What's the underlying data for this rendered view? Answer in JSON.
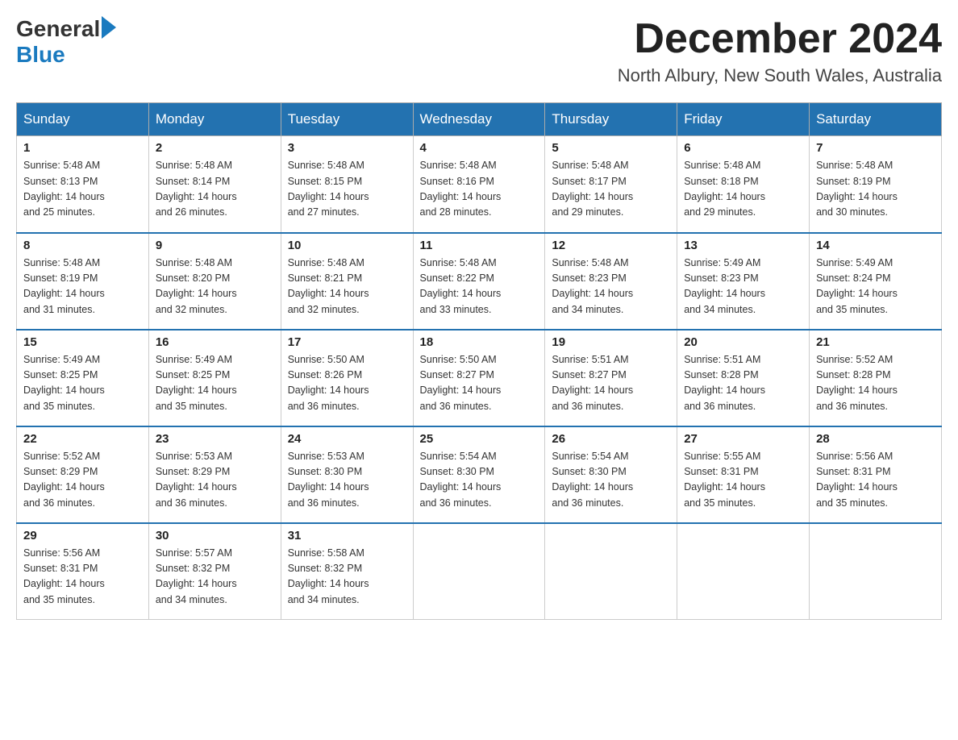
{
  "header": {
    "logo_text1": "General",
    "logo_text2": "Blue",
    "month_title": "December 2024",
    "location": "North Albury, New South Wales, Australia"
  },
  "weekdays": [
    "Sunday",
    "Monday",
    "Tuesday",
    "Wednesday",
    "Thursday",
    "Friday",
    "Saturday"
  ],
  "weeks": [
    [
      {
        "day": "1",
        "sunrise": "5:48 AM",
        "sunset": "8:13 PM",
        "daylight": "14 hours and 25 minutes."
      },
      {
        "day": "2",
        "sunrise": "5:48 AM",
        "sunset": "8:14 PM",
        "daylight": "14 hours and 26 minutes."
      },
      {
        "day": "3",
        "sunrise": "5:48 AM",
        "sunset": "8:15 PM",
        "daylight": "14 hours and 27 minutes."
      },
      {
        "day": "4",
        "sunrise": "5:48 AM",
        "sunset": "8:16 PM",
        "daylight": "14 hours and 28 minutes."
      },
      {
        "day": "5",
        "sunrise": "5:48 AM",
        "sunset": "8:17 PM",
        "daylight": "14 hours and 29 minutes."
      },
      {
        "day": "6",
        "sunrise": "5:48 AM",
        "sunset": "8:18 PM",
        "daylight": "14 hours and 29 minutes."
      },
      {
        "day": "7",
        "sunrise": "5:48 AM",
        "sunset": "8:19 PM",
        "daylight": "14 hours and 30 minutes."
      }
    ],
    [
      {
        "day": "8",
        "sunrise": "5:48 AM",
        "sunset": "8:19 PM",
        "daylight": "14 hours and 31 minutes."
      },
      {
        "day": "9",
        "sunrise": "5:48 AM",
        "sunset": "8:20 PM",
        "daylight": "14 hours and 32 minutes."
      },
      {
        "day": "10",
        "sunrise": "5:48 AM",
        "sunset": "8:21 PM",
        "daylight": "14 hours and 32 minutes."
      },
      {
        "day": "11",
        "sunrise": "5:48 AM",
        "sunset": "8:22 PM",
        "daylight": "14 hours and 33 minutes."
      },
      {
        "day": "12",
        "sunrise": "5:48 AM",
        "sunset": "8:23 PM",
        "daylight": "14 hours and 34 minutes."
      },
      {
        "day": "13",
        "sunrise": "5:49 AM",
        "sunset": "8:23 PM",
        "daylight": "14 hours and 34 minutes."
      },
      {
        "day": "14",
        "sunrise": "5:49 AM",
        "sunset": "8:24 PM",
        "daylight": "14 hours and 35 minutes."
      }
    ],
    [
      {
        "day": "15",
        "sunrise": "5:49 AM",
        "sunset": "8:25 PM",
        "daylight": "14 hours and 35 minutes."
      },
      {
        "day": "16",
        "sunrise": "5:49 AM",
        "sunset": "8:25 PM",
        "daylight": "14 hours and 35 minutes."
      },
      {
        "day": "17",
        "sunrise": "5:50 AM",
        "sunset": "8:26 PM",
        "daylight": "14 hours and 36 minutes."
      },
      {
        "day": "18",
        "sunrise": "5:50 AM",
        "sunset": "8:27 PM",
        "daylight": "14 hours and 36 minutes."
      },
      {
        "day": "19",
        "sunrise": "5:51 AM",
        "sunset": "8:27 PM",
        "daylight": "14 hours and 36 minutes."
      },
      {
        "day": "20",
        "sunrise": "5:51 AM",
        "sunset": "8:28 PM",
        "daylight": "14 hours and 36 minutes."
      },
      {
        "day": "21",
        "sunrise": "5:52 AM",
        "sunset": "8:28 PM",
        "daylight": "14 hours and 36 minutes."
      }
    ],
    [
      {
        "day": "22",
        "sunrise": "5:52 AM",
        "sunset": "8:29 PM",
        "daylight": "14 hours and 36 minutes."
      },
      {
        "day": "23",
        "sunrise": "5:53 AM",
        "sunset": "8:29 PM",
        "daylight": "14 hours and 36 minutes."
      },
      {
        "day": "24",
        "sunrise": "5:53 AM",
        "sunset": "8:30 PM",
        "daylight": "14 hours and 36 minutes."
      },
      {
        "day": "25",
        "sunrise": "5:54 AM",
        "sunset": "8:30 PM",
        "daylight": "14 hours and 36 minutes."
      },
      {
        "day": "26",
        "sunrise": "5:54 AM",
        "sunset": "8:30 PM",
        "daylight": "14 hours and 36 minutes."
      },
      {
        "day": "27",
        "sunrise": "5:55 AM",
        "sunset": "8:31 PM",
        "daylight": "14 hours and 35 minutes."
      },
      {
        "day": "28",
        "sunrise": "5:56 AM",
        "sunset": "8:31 PM",
        "daylight": "14 hours and 35 minutes."
      }
    ],
    [
      {
        "day": "29",
        "sunrise": "5:56 AM",
        "sunset": "8:31 PM",
        "daylight": "14 hours and 35 minutes."
      },
      {
        "day": "30",
        "sunrise": "5:57 AM",
        "sunset": "8:32 PM",
        "daylight": "14 hours and 34 minutes."
      },
      {
        "day": "31",
        "sunrise": "5:58 AM",
        "sunset": "8:32 PM",
        "daylight": "14 hours and 34 minutes."
      },
      null,
      null,
      null,
      null
    ]
  ],
  "labels": {
    "sunrise": "Sunrise:",
    "sunset": "Sunset:",
    "daylight": "Daylight:"
  }
}
